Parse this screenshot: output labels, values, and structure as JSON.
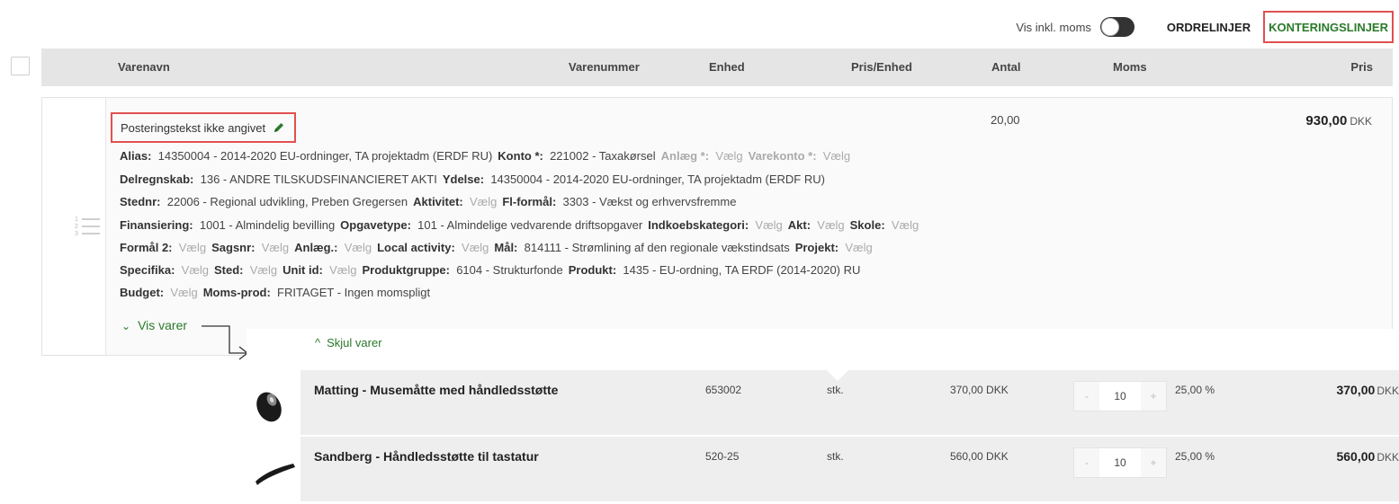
{
  "toolbar": {
    "vat_toggle_label": "Vis inkl. moms",
    "tab_order_lines": "ORDRELINJER",
    "tab_posting_lines": "KONTERINGSLINJER",
    "accent_color": "#2a7a2a",
    "highlight_color": "#e05050"
  },
  "table_header": {
    "name": "Varenavn",
    "number": "Varenummer",
    "unit": "Enhed",
    "unit_price": "Pris/Enhed",
    "quantity": "Antal",
    "vat": "Moms",
    "price": "Pris"
  },
  "posting": {
    "text": "Posteringstekst ikke angivet",
    "quantity": "20,00",
    "price_amount": "930,00",
    "price_currency": "DKK",
    "show_items_label": "Vis varer",
    "attributes": [
      [
        {
          "key": "Alias:",
          "value": "14350004 - 2014-2020 EU-ordninger, TA projektadm (ERDF RU)",
          "muted": false
        },
        {
          "key": "Konto *:",
          "value": "221002 - Taxakørsel",
          "muted": false
        },
        {
          "key": "Anlæg *:",
          "value": "Vælg",
          "muted": true
        },
        {
          "key": "Varekonto *:",
          "value": "Vælg",
          "muted": true
        }
      ],
      [
        {
          "key": "Delregnskab:",
          "value": "136 - ANDRE TILSKUDSFINANCIERET AKTI",
          "muted": false
        },
        {
          "key": "Ydelse:",
          "value": "14350004 - 2014-2020 EU-ordninger, TA projektadm (ERDF RU)",
          "muted": false
        }
      ],
      [
        {
          "key": "Stednr:",
          "value": "22006 - Regional udvikling, Preben Gregersen",
          "muted": false
        },
        {
          "key": "Aktivitet:",
          "value": "Vælg",
          "muted": false,
          "vmuted": true
        },
        {
          "key": "Fl-formål:",
          "value": "3303 - Vækst og erhvervsfremme",
          "muted": false
        }
      ],
      [
        {
          "key": "Finansiering:",
          "value": "1001 - Almindelig bevilling",
          "muted": false
        },
        {
          "key": "Opgavetype:",
          "value": "101 - Almindelige vedvarende driftsopgaver",
          "muted": false
        },
        {
          "key": "Indkoebskategori:",
          "value": "Vælg",
          "muted": false,
          "vmuted": true
        },
        {
          "key": "Akt:",
          "value": "Vælg",
          "muted": false,
          "vmuted": true
        },
        {
          "key": "Skole:",
          "value": "Vælg",
          "muted": false,
          "vmuted": true
        }
      ],
      [
        {
          "key": "Formål 2:",
          "value": "Vælg",
          "muted": false,
          "vmuted": true
        },
        {
          "key": "Sagsnr:",
          "value": "Vælg",
          "muted": false,
          "vmuted": true
        },
        {
          "key": "Anlæg.:",
          "value": "Vælg",
          "muted": false,
          "vmuted": true
        },
        {
          "key": "Local activity:",
          "value": "Vælg",
          "muted": false,
          "vmuted": true
        },
        {
          "key": "Mål:",
          "value": "814111 - Strømlining af den regionale vækstindsats",
          "muted": false
        },
        {
          "key": "Projekt:",
          "value": "Vælg",
          "muted": false,
          "vmuted": true
        }
      ],
      [
        {
          "key": "Specifika:",
          "value": "Vælg",
          "muted": false,
          "vmuted": true
        },
        {
          "key": "Sted:",
          "value": "Vælg",
          "muted": false,
          "vmuted": true
        },
        {
          "key": "Unit id:",
          "value": "Vælg",
          "muted": false,
          "vmuted": true
        },
        {
          "key": "Produktgruppe:",
          "value": "6104 - Strukturfonde",
          "muted": false
        },
        {
          "key": "Produkt:",
          "value": "1435 - EU-ordning, TA ERDF (2014-2020) RU",
          "muted": false
        }
      ],
      [
        {
          "key": "Budget:",
          "value": "Vælg",
          "muted": false,
          "vmuted": true
        },
        {
          "key": "Moms-prod:",
          "value": "FRITAGET - Ingen momspligt",
          "muted": false
        }
      ]
    ]
  },
  "expanded": {
    "hide_items_label": "Skjul varer",
    "items": [
      {
        "name": "Matting - Musemåtte med håndledsstøtte",
        "number": "653002",
        "unit": "stk.",
        "unit_price": "370,00 DKK",
        "quantity": "10",
        "vat": "25,00 %",
        "total_amount": "370,00",
        "total_currency": "DKK",
        "icon": "mousepad-icon"
      },
      {
        "name": "Sandberg - Håndledsstøtte til tastatur",
        "number": "520-25",
        "unit": "stk.",
        "unit_price": "560,00 DKK",
        "quantity": "10",
        "vat": "25,00 %",
        "total_amount": "560,00",
        "total_currency": "DKK",
        "icon": "wrist-rest-icon"
      }
    ],
    "stepper_minus": "-",
    "stepper_plus": "+"
  }
}
